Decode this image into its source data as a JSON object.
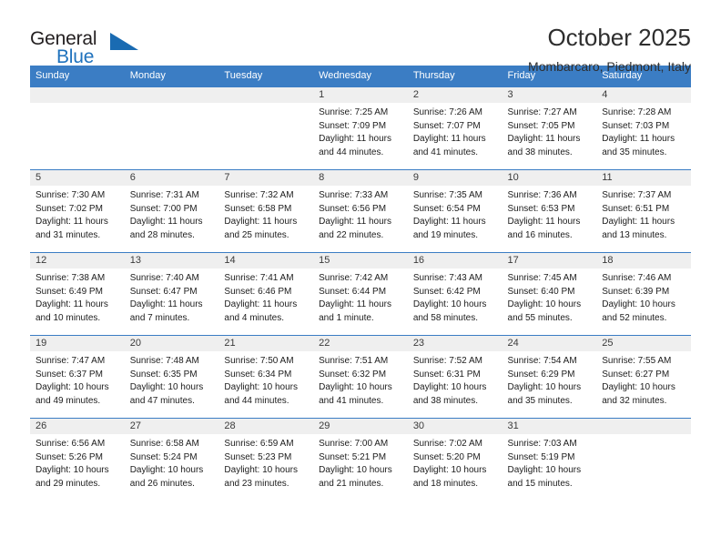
{
  "brand": {
    "name_top": "General",
    "name_bottom": "Blue",
    "triangle_icon": "triangle-icon",
    "accent_color": "#1a6bb2"
  },
  "header": {
    "title": "October 2025",
    "subtitle": "Mombarcaro, Piedmont, Italy"
  },
  "colors": {
    "header_row": "#3b7dc4",
    "day_band": "#efefef",
    "text": "#1c1c1c"
  },
  "weekday_headers": [
    "Sunday",
    "Monday",
    "Tuesday",
    "Wednesday",
    "Thursday",
    "Friday",
    "Saturday"
  ],
  "weeks": [
    [
      {
        "day": "",
        "sunrise": "",
        "sunset": "",
        "daylight_line1": "",
        "daylight_line2": ""
      },
      {
        "day": "",
        "sunrise": "",
        "sunset": "",
        "daylight_line1": "",
        "daylight_line2": ""
      },
      {
        "day": "",
        "sunrise": "",
        "sunset": "",
        "daylight_line1": "",
        "daylight_line2": ""
      },
      {
        "day": "1",
        "sunrise": "Sunrise: 7:25 AM",
        "sunset": "Sunset: 7:09 PM",
        "daylight_line1": "Daylight: 11 hours",
        "daylight_line2": "and 44 minutes."
      },
      {
        "day": "2",
        "sunrise": "Sunrise: 7:26 AM",
        "sunset": "Sunset: 7:07 PM",
        "daylight_line1": "Daylight: 11 hours",
        "daylight_line2": "and 41 minutes."
      },
      {
        "day": "3",
        "sunrise": "Sunrise: 7:27 AM",
        "sunset": "Sunset: 7:05 PM",
        "daylight_line1": "Daylight: 11 hours",
        "daylight_line2": "and 38 minutes."
      },
      {
        "day": "4",
        "sunrise": "Sunrise: 7:28 AM",
        "sunset": "Sunset: 7:03 PM",
        "daylight_line1": "Daylight: 11 hours",
        "daylight_line2": "and 35 minutes."
      }
    ],
    [
      {
        "day": "5",
        "sunrise": "Sunrise: 7:30 AM",
        "sunset": "Sunset: 7:02 PM",
        "daylight_line1": "Daylight: 11 hours",
        "daylight_line2": "and 31 minutes."
      },
      {
        "day": "6",
        "sunrise": "Sunrise: 7:31 AM",
        "sunset": "Sunset: 7:00 PM",
        "daylight_line1": "Daylight: 11 hours",
        "daylight_line2": "and 28 minutes."
      },
      {
        "day": "7",
        "sunrise": "Sunrise: 7:32 AM",
        "sunset": "Sunset: 6:58 PM",
        "daylight_line1": "Daylight: 11 hours",
        "daylight_line2": "and 25 minutes."
      },
      {
        "day": "8",
        "sunrise": "Sunrise: 7:33 AM",
        "sunset": "Sunset: 6:56 PM",
        "daylight_line1": "Daylight: 11 hours",
        "daylight_line2": "and 22 minutes."
      },
      {
        "day": "9",
        "sunrise": "Sunrise: 7:35 AM",
        "sunset": "Sunset: 6:54 PM",
        "daylight_line1": "Daylight: 11 hours",
        "daylight_line2": "and 19 minutes."
      },
      {
        "day": "10",
        "sunrise": "Sunrise: 7:36 AM",
        "sunset": "Sunset: 6:53 PM",
        "daylight_line1": "Daylight: 11 hours",
        "daylight_line2": "and 16 minutes."
      },
      {
        "day": "11",
        "sunrise": "Sunrise: 7:37 AM",
        "sunset": "Sunset: 6:51 PM",
        "daylight_line1": "Daylight: 11 hours",
        "daylight_line2": "and 13 minutes."
      }
    ],
    [
      {
        "day": "12",
        "sunrise": "Sunrise: 7:38 AM",
        "sunset": "Sunset: 6:49 PM",
        "daylight_line1": "Daylight: 11 hours",
        "daylight_line2": "and 10 minutes."
      },
      {
        "day": "13",
        "sunrise": "Sunrise: 7:40 AM",
        "sunset": "Sunset: 6:47 PM",
        "daylight_line1": "Daylight: 11 hours",
        "daylight_line2": "and 7 minutes."
      },
      {
        "day": "14",
        "sunrise": "Sunrise: 7:41 AM",
        "sunset": "Sunset: 6:46 PM",
        "daylight_line1": "Daylight: 11 hours",
        "daylight_line2": "and 4 minutes."
      },
      {
        "day": "15",
        "sunrise": "Sunrise: 7:42 AM",
        "sunset": "Sunset: 6:44 PM",
        "daylight_line1": "Daylight: 11 hours",
        "daylight_line2": "and 1 minute."
      },
      {
        "day": "16",
        "sunrise": "Sunrise: 7:43 AM",
        "sunset": "Sunset: 6:42 PM",
        "daylight_line1": "Daylight: 10 hours",
        "daylight_line2": "and 58 minutes."
      },
      {
        "day": "17",
        "sunrise": "Sunrise: 7:45 AM",
        "sunset": "Sunset: 6:40 PM",
        "daylight_line1": "Daylight: 10 hours",
        "daylight_line2": "and 55 minutes."
      },
      {
        "day": "18",
        "sunrise": "Sunrise: 7:46 AM",
        "sunset": "Sunset: 6:39 PM",
        "daylight_line1": "Daylight: 10 hours",
        "daylight_line2": "and 52 minutes."
      }
    ],
    [
      {
        "day": "19",
        "sunrise": "Sunrise: 7:47 AM",
        "sunset": "Sunset: 6:37 PM",
        "daylight_line1": "Daylight: 10 hours",
        "daylight_line2": "and 49 minutes."
      },
      {
        "day": "20",
        "sunrise": "Sunrise: 7:48 AM",
        "sunset": "Sunset: 6:35 PM",
        "daylight_line1": "Daylight: 10 hours",
        "daylight_line2": "and 47 minutes."
      },
      {
        "day": "21",
        "sunrise": "Sunrise: 7:50 AM",
        "sunset": "Sunset: 6:34 PM",
        "daylight_line1": "Daylight: 10 hours",
        "daylight_line2": "and 44 minutes."
      },
      {
        "day": "22",
        "sunrise": "Sunrise: 7:51 AM",
        "sunset": "Sunset: 6:32 PM",
        "daylight_line1": "Daylight: 10 hours",
        "daylight_line2": "and 41 minutes."
      },
      {
        "day": "23",
        "sunrise": "Sunrise: 7:52 AM",
        "sunset": "Sunset: 6:31 PM",
        "daylight_line1": "Daylight: 10 hours",
        "daylight_line2": "and 38 minutes."
      },
      {
        "day": "24",
        "sunrise": "Sunrise: 7:54 AM",
        "sunset": "Sunset: 6:29 PM",
        "daylight_line1": "Daylight: 10 hours",
        "daylight_line2": "and 35 minutes."
      },
      {
        "day": "25",
        "sunrise": "Sunrise: 7:55 AM",
        "sunset": "Sunset: 6:27 PM",
        "daylight_line1": "Daylight: 10 hours",
        "daylight_line2": "and 32 minutes."
      }
    ],
    [
      {
        "day": "26",
        "sunrise": "Sunrise: 6:56 AM",
        "sunset": "Sunset: 5:26 PM",
        "daylight_line1": "Daylight: 10 hours",
        "daylight_line2": "and 29 minutes."
      },
      {
        "day": "27",
        "sunrise": "Sunrise: 6:58 AM",
        "sunset": "Sunset: 5:24 PM",
        "daylight_line1": "Daylight: 10 hours",
        "daylight_line2": "and 26 minutes."
      },
      {
        "day": "28",
        "sunrise": "Sunrise: 6:59 AM",
        "sunset": "Sunset: 5:23 PM",
        "daylight_line1": "Daylight: 10 hours",
        "daylight_line2": "and 23 minutes."
      },
      {
        "day": "29",
        "sunrise": "Sunrise: 7:00 AM",
        "sunset": "Sunset: 5:21 PM",
        "daylight_line1": "Daylight: 10 hours",
        "daylight_line2": "and 21 minutes."
      },
      {
        "day": "30",
        "sunrise": "Sunrise: 7:02 AM",
        "sunset": "Sunset: 5:20 PM",
        "daylight_line1": "Daylight: 10 hours",
        "daylight_line2": "and 18 minutes."
      },
      {
        "day": "31",
        "sunrise": "Sunrise: 7:03 AM",
        "sunset": "Sunset: 5:19 PM",
        "daylight_line1": "Daylight: 10 hours",
        "daylight_line2": "and 15 minutes."
      },
      {
        "day": "",
        "sunrise": "",
        "sunset": "",
        "daylight_line1": "",
        "daylight_line2": ""
      }
    ]
  ]
}
